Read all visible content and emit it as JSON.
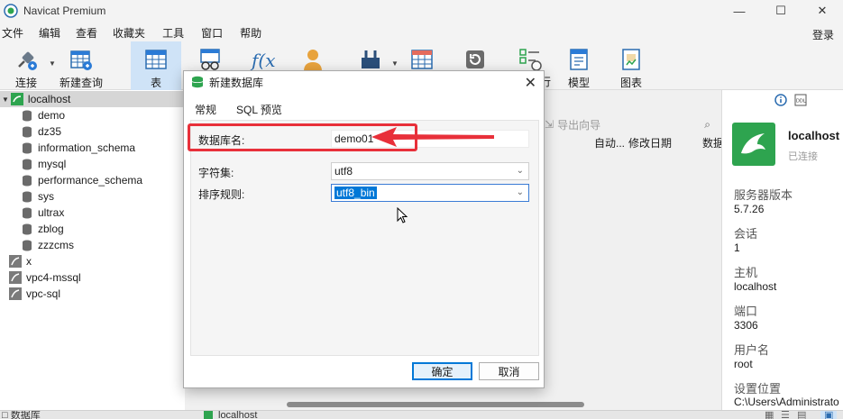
{
  "window": {
    "title": "Navicat Premium",
    "minimize": "—",
    "maximize": "☐",
    "close": "✕"
  },
  "menu": {
    "items": [
      "文件",
      "编辑",
      "查看",
      "收藏夹",
      "工具",
      "窗口",
      "帮助"
    ],
    "login": "登录"
  },
  "toolbar": {
    "connect_label": "连接",
    "new_query_label": "新建查询",
    "table_label": "表",
    "model_label": "模型",
    "chart_label": "图表",
    "partial_label": "行"
  },
  "tree": {
    "connection": "localhost",
    "databases": [
      "demo",
      "dz35",
      "information_schema",
      "mysql",
      "performance_schema",
      "sys",
      "ultrax",
      "zblog",
      "zzzcms"
    ],
    "other_connections": [
      "x",
      "vpc4-mssql",
      "vpc-sql"
    ]
  },
  "object_pane": {
    "export_wizard": "导出向导",
    "columns": [
      "自动...",
      "修改日期",
      "数据"
    ]
  },
  "info_panel": {
    "conn_name": "localhost",
    "conn_status": "已连接",
    "fields": [
      {
        "label": "服务器版本",
        "value": "5.7.26"
      },
      {
        "label": "会话",
        "value": "1"
      },
      {
        "label": "主机",
        "value": "localhost"
      },
      {
        "label": "端口",
        "value": "3306"
      },
      {
        "label": "用户名",
        "value": "root"
      },
      {
        "label": "设置位置",
        "value": "C:\\Users\\Administrato"
      }
    ]
  },
  "status_bar": {
    "left": "□ 数据库",
    "center": "localhost"
  },
  "dialog": {
    "title": "新建数据库",
    "close": "✕",
    "tabs": [
      "常规",
      "SQL 预览"
    ],
    "db_name_label": "数据库名:",
    "db_name_value": "demo01",
    "charset_label": "字符集:",
    "charset_value": "utf8",
    "collation_label": "排序规则:",
    "collation_value": "utf8_bin",
    "ok_label": "确定",
    "cancel_label": "取消"
  },
  "colors": {
    "highlight_red": "#e8303a",
    "accent_blue": "#0078d7",
    "mysql_green": "#2ea44f"
  }
}
